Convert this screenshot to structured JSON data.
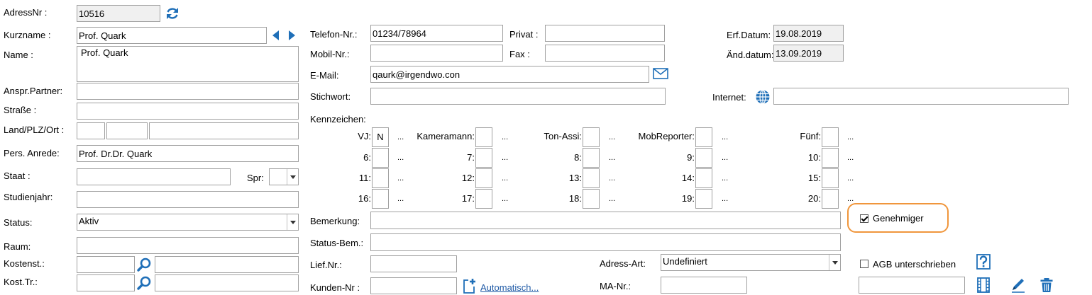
{
  "address": {
    "nr_label": "AdressNr :",
    "nr": "10516",
    "kurzname_label": "Kurzname :",
    "kurzname": "Prof. Quark",
    "name_label": "Name :",
    "name": "Prof. Quark",
    "ansprech_label": "Anspr.Partner:",
    "strasse_label": "Straße :",
    "land_label": "Land/PLZ/Ort :",
    "anrede_label": "Pers. Anrede:",
    "anrede": "Prof. Dr.Dr. Quark",
    "staat_label": "Staat :",
    "spr_label": "Spr:",
    "studienjahr_label": "Studienjahr:",
    "status_label": "Status:",
    "status": "Aktiv",
    "raum_label": "Raum:",
    "kostenst_label": "Kostenst.:",
    "kosttr_label": "Kost.Tr.:"
  },
  "contact": {
    "telefon_label": "Telefon-Nr.:",
    "telefon": "01234/78964",
    "privat_label": "Privat :",
    "mobil_label": "Mobil-Nr.:",
    "fax_label": "Fax :",
    "email_label": "E-Mail:",
    "email": "qaurk@irgendwo.con",
    "stichwort_label": "Stichwort:",
    "internet_label": "Internet:"
  },
  "dates": {
    "erf_label": "Erf.Datum:",
    "erf": "19.08.2019",
    "aend_label": "Änd.datum:",
    "aend": "13.09.2019"
  },
  "kennzeichen": {
    "title": "Kennzeichen:",
    "dots": "...",
    "items": [
      {
        "label": "VJ:",
        "value": "N"
      },
      {
        "label": "Kameramann:",
        "value": ""
      },
      {
        "label": "Ton-Assi:",
        "value": ""
      },
      {
        "label": "MobReporter:",
        "value": ""
      },
      {
        "label": "Fünf:",
        "value": ""
      },
      {
        "label": "6:",
        "value": ""
      },
      {
        "label": "7:",
        "value": ""
      },
      {
        "label": "8:",
        "value": ""
      },
      {
        "label": "9:",
        "value": ""
      },
      {
        "label": "10:",
        "value": ""
      },
      {
        "label": "11:",
        "value": ""
      },
      {
        "label": "12:",
        "value": ""
      },
      {
        "label": "13:",
        "value": ""
      },
      {
        "label": "14:",
        "value": ""
      },
      {
        "label": "15:",
        "value": ""
      },
      {
        "label": "16:",
        "value": ""
      },
      {
        "label": "17:",
        "value": ""
      },
      {
        "label": "18:",
        "value": ""
      },
      {
        "label": "19:",
        "value": ""
      },
      {
        "label": "20:",
        "value": ""
      }
    ]
  },
  "misc": {
    "bemerkung_label": "Bemerkung:",
    "statusbem_label": "Status-Bem.:",
    "liefnr_label": "Lief.Nr.:",
    "kundennr_label": "Kunden-Nr :",
    "automatisch_link": "Automatisch...",
    "adressart_label": "Adress-Art:",
    "adressart": "Undefiniert",
    "manr_label": "MA-Nr.:",
    "genehmiger_label": "Genehmiger",
    "genehmiger_checked": true,
    "agb_label": "AGB unterschrieben",
    "agb_checked": false
  },
  "colors": {
    "icon_blue": "#1f6fb8",
    "highlight_orange": "#f0963c"
  },
  "icons": [
    "refresh-icon",
    "arrow-left-icon",
    "arrow-right-icon",
    "mail-icon",
    "globe-icon",
    "search-icon",
    "add-document-icon",
    "help-icon",
    "film-icon",
    "edit-icon",
    "trash-icon"
  ]
}
